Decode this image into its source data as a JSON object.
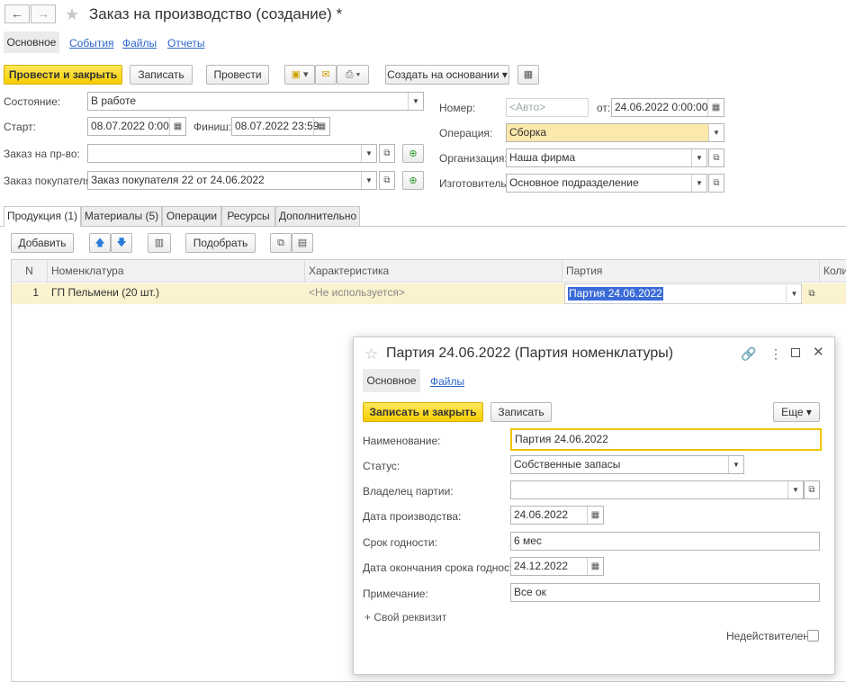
{
  "window": {
    "title": "Заказ на производство (создание) *",
    "nav_back": "←",
    "nav_forward": "→"
  },
  "nav_tabs": [
    "Основное",
    "События",
    "Файлы",
    "Отчеты"
  ],
  "toolbar": {
    "post_close": "Провести и закрыть",
    "save": "Записать",
    "post": "Провести",
    "create_based": "Создать на основании"
  },
  "form": {
    "state_label": "Состояние:",
    "state_value": "В работе",
    "start_label": "Старт:",
    "start_value": "08.07.2022  0:00",
    "finish_label": "Финиш:",
    "finish_value": "08.07.2022 23:59",
    "prod_order_label": "Заказ на пр-во:",
    "prod_order_value": "",
    "customer_order_label": "Заказ покупателя:",
    "customer_order_value": "Заказ покупателя 22 от 24.06.2022",
    "number_label": "Номер:",
    "number_placeholder": "<Авто>",
    "from_label": "от:",
    "from_value": "24.06.2022  0:00:00",
    "operation_label": "Операция:",
    "operation_value": "Сборка",
    "org_label": "Организация:",
    "org_value": "Наша фирма",
    "maker_label": "Изготовитель:",
    "maker_value": "Основное подразделение"
  },
  "sub_tabs": [
    "Продукция (1)",
    "Материалы (5)",
    "Операции",
    "Ресурсы",
    "Дополнительно"
  ],
  "table_toolbar": {
    "add": "Добавить",
    "pick": "Подобрать"
  },
  "table": {
    "columns": [
      "N",
      "Номенклатура",
      "Характеристика",
      "Партия",
      "Коли"
    ],
    "rows": [
      {
        "n": "1",
        "item": "ГП Пельмени (20 шт.)",
        "characteristic": "<Не используется>",
        "batch": "Партия 24.06.2022"
      }
    ]
  },
  "dialog": {
    "title": "Партия 24.06.2022 (Партия номенклатуры)",
    "tabs": [
      "Основное",
      "Файлы"
    ],
    "save_close": "Записать и закрыть",
    "save": "Записать",
    "more": "Еще",
    "name_label": "Наименование:",
    "name_value": "Партия 24.06.2022",
    "status_label": "Статус:",
    "status_value": "Собственные запасы",
    "owner_label": "Владелец партии:",
    "owner_value": "",
    "prod_date_label": "Дата производства:",
    "prod_date_value": "24.06.2022",
    "shelf_label": "Срок годности:",
    "shelf_value": "6 мес",
    "expiry_label": "Дата окончания срока годности:",
    "expiry_value": "24.12.2022",
    "note_label": "Примечание:",
    "note_value": "Все ок",
    "custom_attr": "+ Свой реквизит",
    "invalid_label": "Недействителен:"
  }
}
